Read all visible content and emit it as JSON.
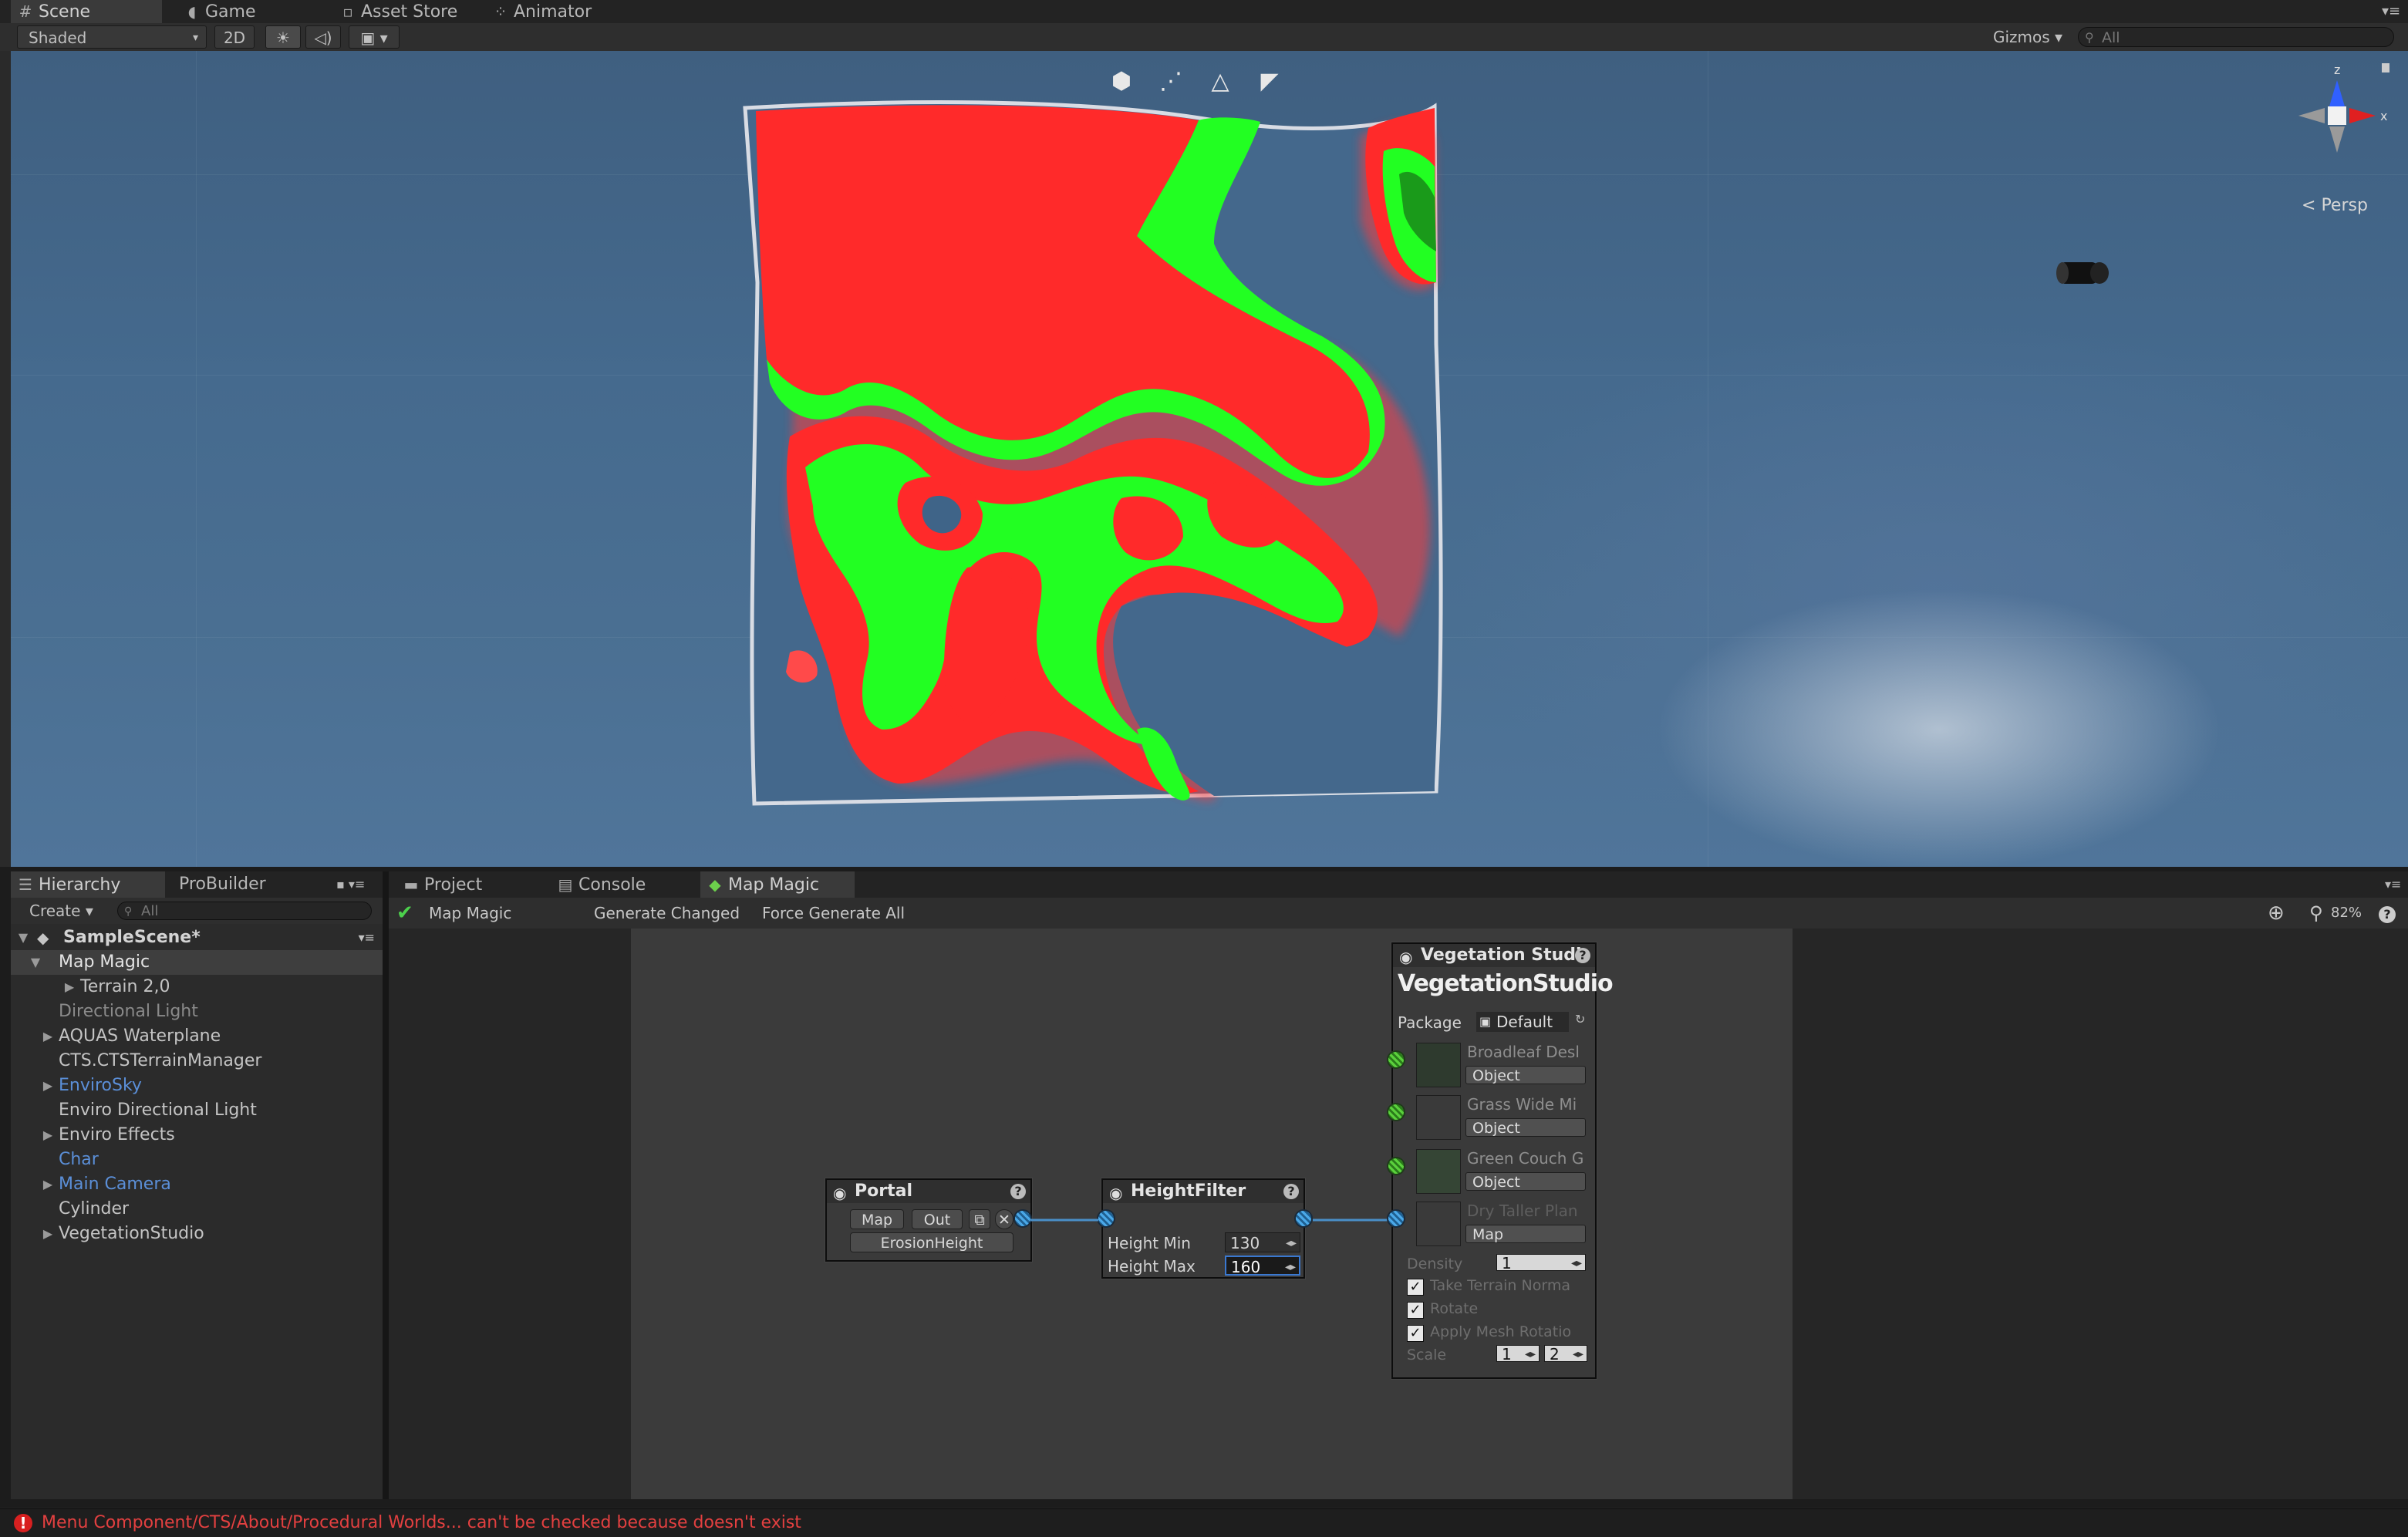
{
  "scene_tabs": [
    {
      "label": "Scene",
      "icon": "grid-icon"
    },
    {
      "label": "Game",
      "icon": "pacman-icon"
    },
    {
      "label": "Asset Store",
      "icon": "bag-icon"
    },
    {
      "label": "Animator",
      "icon": "animator-icon"
    }
  ],
  "scene_toolbar": {
    "draw_mode": "Shaded",
    "mode_2d": "2D",
    "gizmos": "Gizmos",
    "search_placeholder": "All",
    "projection": "Persp"
  },
  "axis_gizmo": {
    "y": "z",
    "x": "x"
  },
  "hierarchy": {
    "tabs": [
      "Hierarchy",
      "ProBuilder"
    ],
    "create_label": "Create",
    "search_placeholder": "All",
    "scene_name": "SampleScene*",
    "items": [
      {
        "label": "Map Magic",
        "expanded": true,
        "selected": true
      },
      {
        "label": "Terrain 2,0",
        "has_children": true
      },
      {
        "label": "Directional Light",
        "dim": true
      },
      {
        "label": "AQUAS Waterplane",
        "has_children": true
      },
      {
        "label": "CTS.CTSTerrainManager"
      },
      {
        "label": "EnviroSky",
        "has_children": true,
        "blue": true
      },
      {
        "label": "Enviro Directional Light"
      },
      {
        "label": "Enviro Effects",
        "has_children": true
      },
      {
        "label": "Char",
        "blue": true
      },
      {
        "label": "Main Camera",
        "has_children": true,
        "blue": true
      },
      {
        "label": "Cylinder"
      },
      {
        "label": "VegetationStudio",
        "has_children": true
      }
    ]
  },
  "bottom_tabs": [
    "Project",
    "Console",
    "Map Magic"
  ],
  "map_magic_toolbar": {
    "title": "Map Magic",
    "generate_changed": "Generate Changed",
    "force_generate_all": "Force Generate All",
    "zoom": "82%"
  },
  "nodes": {
    "portal": {
      "title": "Portal",
      "map": "Map",
      "out": "Out",
      "name": "ErosionHeight"
    },
    "height_filter": {
      "title": "HeightFilter",
      "min_label": "Height Min",
      "min_value": "130",
      "max_label": "Height Max",
      "max_value": "160"
    },
    "vegetation": {
      "title": "Vegetation Studi",
      "logo": "VegetationStudio",
      "package_label": "Package",
      "package_value": "Default",
      "items": [
        {
          "name": "Broadleaf Desl",
          "type": "Object"
        },
        {
          "name": "Grass Wide Mi",
          "type": "Object"
        },
        {
          "name": "Green Couch G",
          "type": "Object"
        },
        {
          "name": "Dry Taller Plan",
          "type": "Map"
        }
      ],
      "density_label": "Density",
      "density_value": "1",
      "take_terrain_normals": "Take Terrain Norma",
      "rotate": "Rotate",
      "apply_mesh_rotation": "Apply Mesh Rotatio",
      "scale_label": "Scale",
      "scale_min": "1",
      "scale_max": "2"
    }
  },
  "status": {
    "message": "Menu Component/CTS/About/Procedural Worlds... can't be checked because doesn't exist",
    "color": "#e34040"
  },
  "colors": {
    "terrain_red": "#ff2a2a",
    "terrain_green": "#22ff22",
    "water": "#4a6f92",
    "accent": "#3a78d0"
  }
}
